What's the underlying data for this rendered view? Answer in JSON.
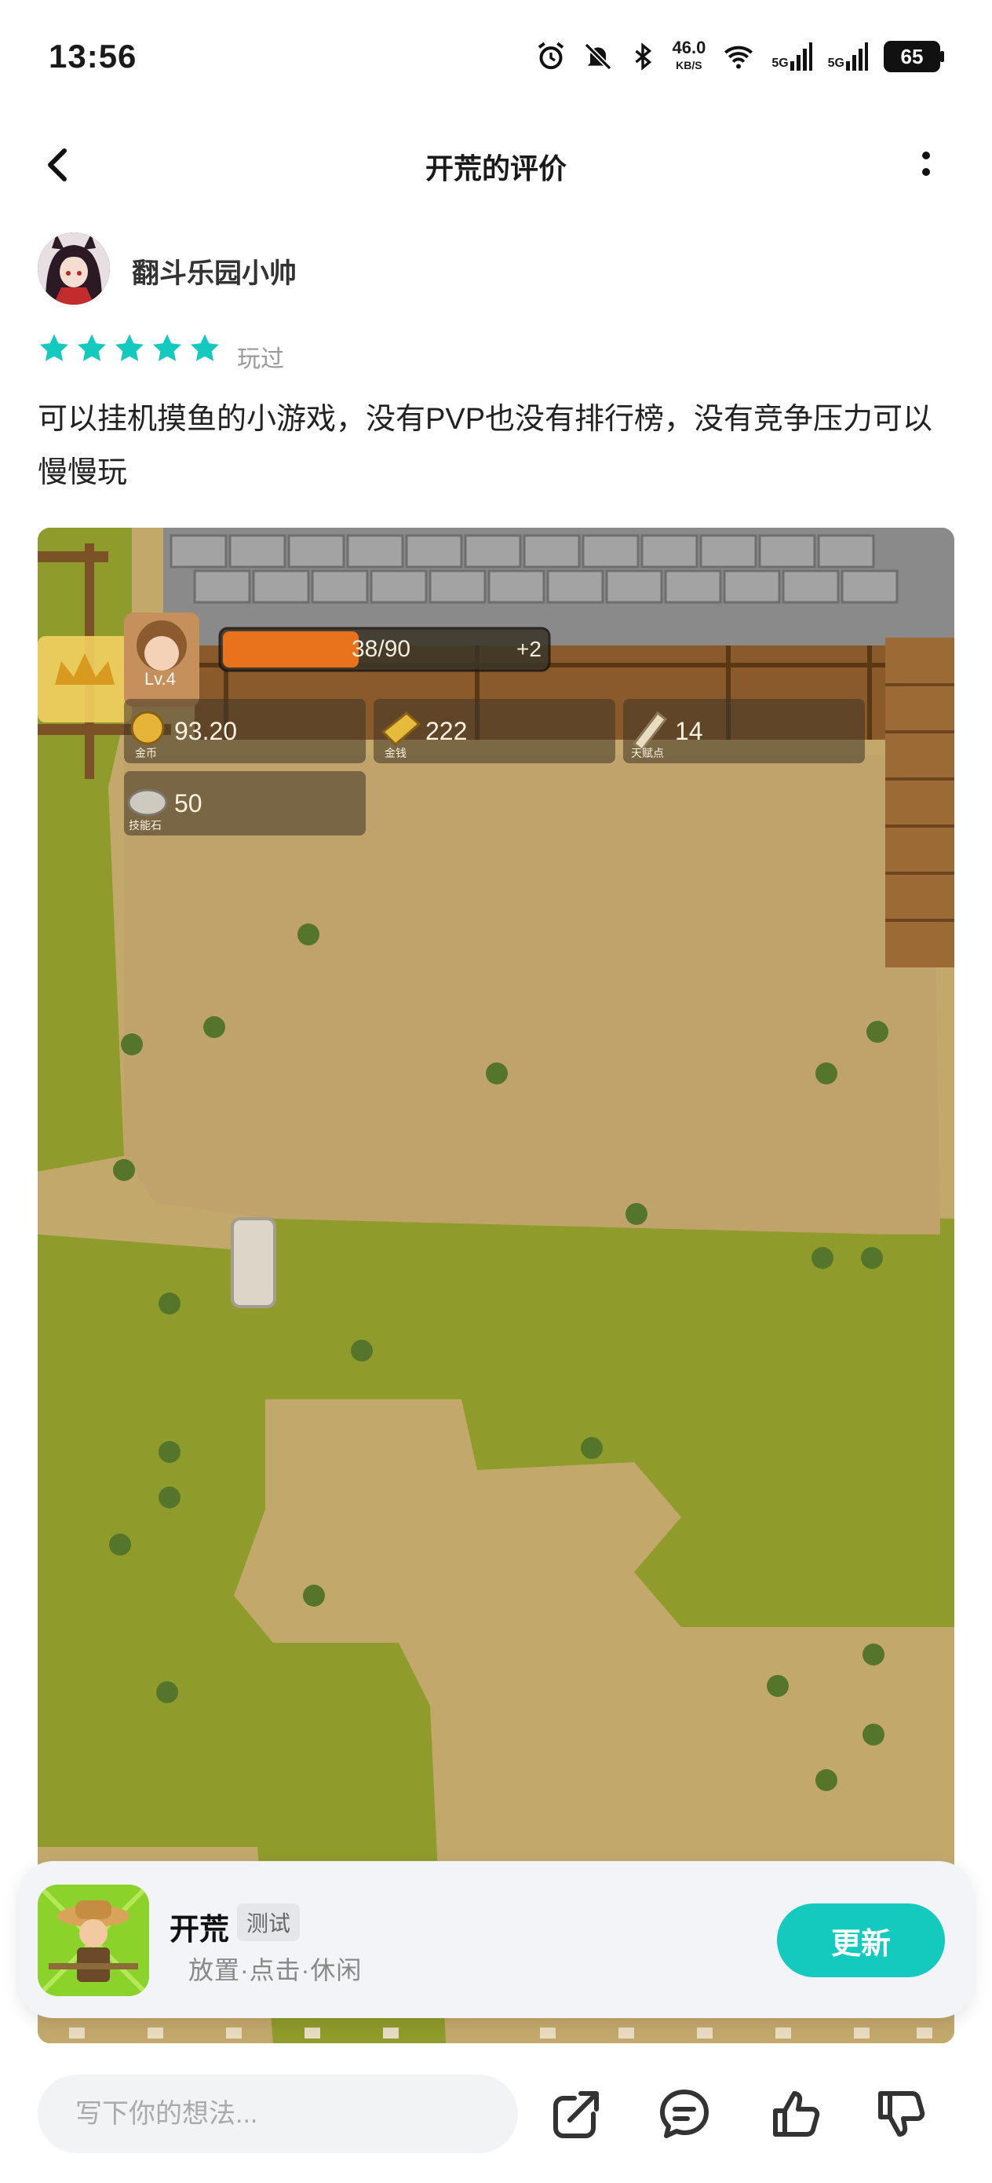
{
  "status_bar": {
    "time": "13:56",
    "net_speed_value": "46.0",
    "net_speed_unit": "KB/S",
    "signal1": "5G",
    "signal2": "5G",
    "battery": "65"
  },
  "header": {
    "title": "开荒的评价"
  },
  "review": {
    "username": "翻斗乐园小帅",
    "rating": 5,
    "status": "玩过",
    "text": "可以挂机摸鱼的小游戏，没有PVP也没有排行榜，没有竞争压力可以慢慢玩"
  },
  "game_hud": {
    "level": "Lv.4",
    "xp": "38/90",
    "xp_fraction": 0.42,
    "plus": "+2",
    "coins_value": "93.20",
    "coins_label": "金币",
    "gold_value": "222",
    "gold_label": "金钱",
    "talent_value": "14",
    "talent_label": "天赋点",
    "stone_value": "50",
    "stone_label": "技能石"
  },
  "app_card": {
    "name": "开荒",
    "badge": "测试",
    "tags": "放置·点击·休闲",
    "button": "更新"
  },
  "bottom_bar": {
    "placeholder": "写下你的想法..."
  },
  "colors": {
    "accent": "#14c9bd",
    "star": "#14c9bd"
  }
}
